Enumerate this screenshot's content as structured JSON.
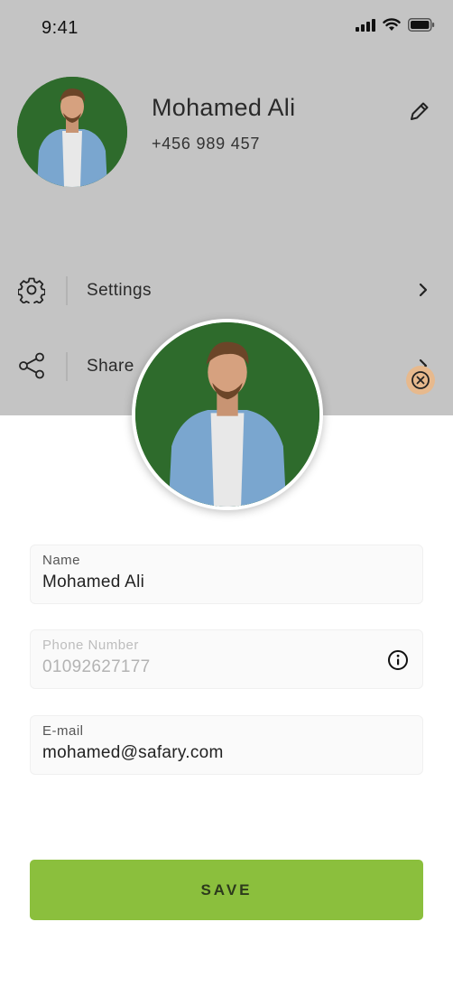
{
  "status_bar": {
    "time": "9:41"
  },
  "profile": {
    "name": "Mohamed Ali",
    "phone": "+456 989 457"
  },
  "menu": [
    {
      "label": "Settings",
      "icon": "gear-icon"
    },
    {
      "label": "Share",
      "icon": "share-icon"
    }
  ],
  "form": {
    "name": {
      "label": "Name",
      "value": "Mohamed Ali"
    },
    "phone": {
      "label": "Phone Number",
      "value": "01092627177"
    },
    "email": {
      "label": "E-mail",
      "value": "mohamed@safary.com"
    }
  },
  "save_label": "SAVE",
  "colors": {
    "accent": "#8bbf3d",
    "avatar_bg": "#2e6b2c",
    "close_bg": "#e7b98d",
    "overlay": "#c4c4c4"
  }
}
